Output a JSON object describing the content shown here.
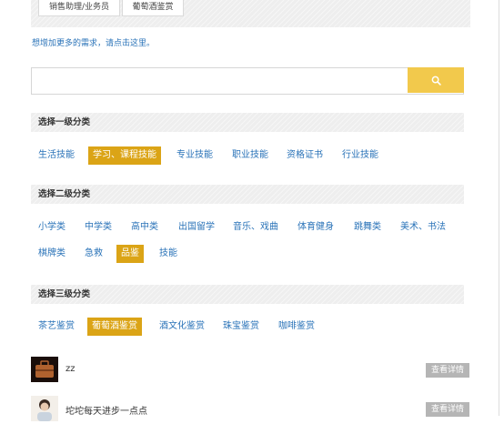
{
  "top_tabs": [
    "销售助理/业务员",
    "葡萄酒鉴赏"
  ],
  "more_link": "想增加更多的需求，请点击这里。",
  "search": {
    "placeholder": ""
  },
  "level1": {
    "title": "选择一级分类",
    "items": [
      "生活技能",
      "学习、课程技能",
      "专业技能",
      "职业技能",
      "资格证书",
      "行业技能"
    ],
    "active_index": 1
  },
  "level2": {
    "title": "选择二级分类",
    "row1": [
      "小学类",
      "中学类",
      "高中类",
      "出国留学",
      "音乐、戏曲",
      "体育健身",
      "跳舞类",
      "美术、书法"
    ],
    "row2": [
      "棋牌类",
      "急救",
      "品鉴",
      "技能"
    ],
    "active_label": "品鉴"
  },
  "level3": {
    "title": "选择三级分类",
    "items": [
      "茶艺鉴赏",
      "葡萄酒鉴赏",
      "酒文化鉴赏",
      "珠宝鉴赏",
      "咖啡鉴赏"
    ],
    "active_index": 1
  },
  "users": [
    {
      "name": "zz",
      "button": "查看详情"
    },
    {
      "name": "坨坨每天进步一点点",
      "button": "查看详情"
    }
  ],
  "colors": {
    "accent": "#dba416",
    "link": "#2a73b8",
    "search_button": "#f2c94c",
    "detail_button": "#b5b5b5"
  }
}
